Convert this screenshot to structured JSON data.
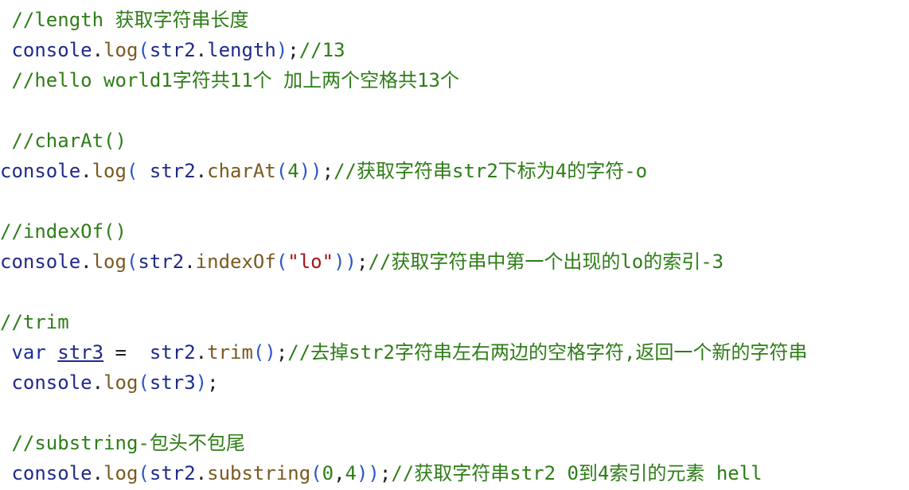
{
  "lines": [
    {
      "indent": " ",
      "tokens": [
        {
          "t": "//length 获取字符串长度",
          "c": "c"
        }
      ]
    },
    {
      "indent": " ",
      "tokens": [
        {
          "t": "console",
          "c": "id"
        },
        {
          "t": ".",
          "c": "p"
        },
        {
          "t": "log",
          "c": "fn"
        },
        {
          "t": "(",
          "c": "paren"
        },
        {
          "t": "str2",
          "c": "id"
        },
        {
          "t": ".",
          "c": "p"
        },
        {
          "t": "length",
          "c": "id"
        },
        {
          "t": ")",
          "c": "paren"
        },
        {
          "t": ";",
          "c": "p"
        },
        {
          "t": "//13",
          "c": "c"
        }
      ]
    },
    {
      "indent": " ",
      "tokens": [
        {
          "t": "//hello world1字符共11个 加上两个空格共13个",
          "c": "c"
        }
      ]
    },
    {
      "indent": "",
      "tokens": []
    },
    {
      "indent": " ",
      "tokens": [
        {
          "t": "//charAt()",
          "c": "c"
        }
      ]
    },
    {
      "indent": "",
      "tokens": [
        {
          "t": "console",
          "c": "id"
        },
        {
          "t": ".",
          "c": "p"
        },
        {
          "t": "log",
          "c": "fn"
        },
        {
          "t": "( ",
          "c": "paren"
        },
        {
          "t": "str2",
          "c": "id"
        },
        {
          "t": ".",
          "c": "p"
        },
        {
          "t": "charAt",
          "c": "mth"
        },
        {
          "t": "(",
          "c": "paren"
        },
        {
          "t": "4",
          "c": "num"
        },
        {
          "t": "))",
          "c": "paren"
        },
        {
          "t": ";",
          "c": "p"
        },
        {
          "t": "//获取字符串str2下标为4的字符-o",
          "c": "c"
        }
      ]
    },
    {
      "indent": "",
      "tokens": []
    },
    {
      "indent": "",
      "tokens": [
        {
          "t": "//indexOf()",
          "c": "c"
        }
      ]
    },
    {
      "indent": "",
      "tokens": [
        {
          "t": "console",
          "c": "id"
        },
        {
          "t": ".",
          "c": "p"
        },
        {
          "t": "log",
          "c": "fn"
        },
        {
          "t": "(",
          "c": "paren"
        },
        {
          "t": "str2",
          "c": "id"
        },
        {
          "t": ".",
          "c": "p"
        },
        {
          "t": "indexOf",
          "c": "mth"
        },
        {
          "t": "(",
          "c": "paren"
        },
        {
          "t": "\"lo\"",
          "c": "str"
        },
        {
          "t": "))",
          "c": "paren"
        },
        {
          "t": ";",
          "c": "p"
        },
        {
          "t": "//获取字符串中第一个出现的lo的索引-3",
          "c": "c"
        }
      ]
    },
    {
      "indent": "",
      "tokens": []
    },
    {
      "indent": "",
      "tokens": [
        {
          "t": "//trim",
          "c": "c"
        }
      ]
    },
    {
      "indent": " ",
      "tokens": [
        {
          "t": "var",
          "c": "kw"
        },
        {
          "t": " ",
          "c": "p"
        },
        {
          "t": "str3",
          "c": "ul"
        },
        {
          "t": " =  ",
          "c": "p"
        },
        {
          "t": "str2",
          "c": "id"
        },
        {
          "t": ".",
          "c": "p"
        },
        {
          "t": "trim",
          "c": "mth"
        },
        {
          "t": "()",
          "c": "paren"
        },
        {
          "t": ";",
          "c": "p"
        },
        {
          "t": "//去掉str2字符串左右两边的空格字符,返回一个新的字符串",
          "c": "c"
        }
      ]
    },
    {
      "indent": " ",
      "tokens": [
        {
          "t": "console",
          "c": "id"
        },
        {
          "t": ".",
          "c": "p"
        },
        {
          "t": "log",
          "c": "fn"
        },
        {
          "t": "(",
          "c": "paren"
        },
        {
          "t": "str3",
          "c": "id"
        },
        {
          "t": ")",
          "c": "paren"
        },
        {
          "t": ";",
          "c": "p"
        }
      ]
    },
    {
      "indent": "",
      "tokens": []
    },
    {
      "indent": " ",
      "tokens": [
        {
          "t": "//substring-包头不包尾",
          "c": "c"
        }
      ]
    },
    {
      "indent": " ",
      "tokens": [
        {
          "t": "console",
          "c": "id"
        },
        {
          "t": ".",
          "c": "p"
        },
        {
          "t": "log",
          "c": "fn"
        },
        {
          "t": "(",
          "c": "paren"
        },
        {
          "t": "str2",
          "c": "id"
        },
        {
          "t": ".",
          "c": "p"
        },
        {
          "t": "substring",
          "c": "mth"
        },
        {
          "t": "(",
          "c": "paren"
        },
        {
          "t": "0",
          "c": "num"
        },
        {
          "t": ",",
          "c": "p"
        },
        {
          "t": "4",
          "c": "num"
        },
        {
          "t": "))",
          "c": "paren"
        },
        {
          "t": ";",
          "c": "p"
        },
        {
          "t": "//获取字符串str2 0到4索引的元素 hell",
          "c": "c"
        }
      ]
    }
  ]
}
